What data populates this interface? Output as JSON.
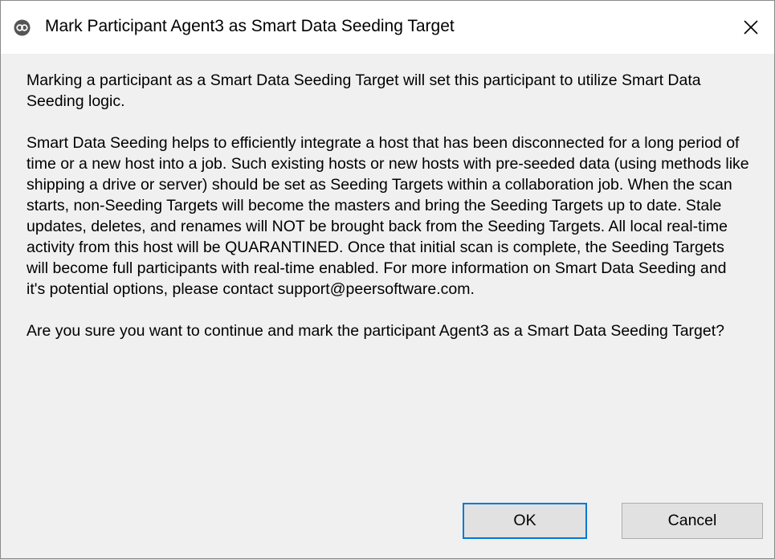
{
  "window": {
    "title": "Mark Participant Agent3 as Smart Data Seeding Target",
    "app_icon": "peer-software-icon",
    "close_icon": "close-icon"
  },
  "message": {
    "paragraph1": "Marking a participant as a Smart Data Seeding Target will set this participant to utilize Smart Data Seeding logic.",
    "paragraph2": "Smart Data Seeding helps to efficiently integrate a host that has been disconnected for a long period of time or a new host into a job.  Such existing hosts or new hosts with pre-seeded data (using methods like shipping a drive or server) should be set as Seeding Targets within a collaboration job. When the scan starts, non-Seeding Targets will become the masters and bring the Seeding Targets up to date. Stale updates, deletes, and renames will NOT be brought back from the Seeding Targets.  All local real-time activity from this host will be QUARANTINED.  Once that initial scan is complete, the Seeding Targets will become full participants with real-time enabled.  For more information on Smart Data Seeding and it's potential options, please contact support@peersoftware.com.",
    "paragraph3": "Are you sure you want to continue and mark the participant Agent3 as a Smart Data Seeding Target?"
  },
  "buttons": {
    "ok_label": "OK",
    "cancel_label": "Cancel"
  },
  "colors": {
    "dialog_background": "#f0f0f0",
    "titlebar_background": "#ffffff",
    "default_button_border": "#0078d7",
    "button_background": "#e1e1e1"
  }
}
